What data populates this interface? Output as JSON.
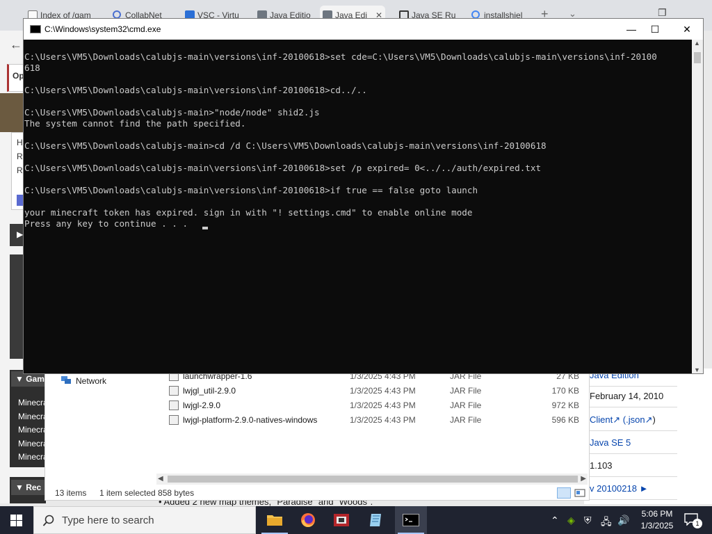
{
  "browser": {
    "tabs": [
      {
        "label": "Index of /gam",
        "icon": "file-page-icon",
        "color": "#6b6b6b"
      },
      {
        "label": "CollabNet",
        "icon": "magnifier-icon",
        "color": "#4a6fd0"
      },
      {
        "label": "VSC - Virtu",
        "icon": "vsc-icon",
        "color": "#2b6fd6"
      },
      {
        "label": "Java Editio",
        "icon": "minecraft-block-icon",
        "color": "#6e7680"
      },
      {
        "label": "Java Edi",
        "icon": "minecraft-block-icon",
        "color": "#6e7680"
      },
      {
        "label": "Java SE Ru",
        "icon": "pillars-icon",
        "color": "#333333"
      },
      {
        "label": "installshiel",
        "icon": "google-icon",
        "color": "#4285f4"
      }
    ],
    "left_fragments": {
      "op": "Op",
      "h": "H",
      "r1": "R",
      "r2": "R",
      "games_heading": "Gam",
      "minecraft_links": [
        "Minecra",
        "Minecra",
        "Minecra",
        "Minecra",
        "Minecra"
      ],
      "recent_heading": "Rec"
    },
    "wiki_infobox": {
      "row1": "Java Edition",
      "row2": "February 14, 2010",
      "row3_client": "Client",
      "row3_json": "(.json",
      "row3_end": ")",
      "row4": "Java SE 5",
      "row5": "1.103",
      "row6": "v 20100218 ►"
    },
    "page_bottom_text": "• Added 2 new map themes, \"Paradise\" and \"Woods\"."
  },
  "explorer": {
    "nav_item": "Network",
    "files": [
      {
        "name": "launchwrapper-1.6",
        "date": "1/3/2025 4:43 PM",
        "type": "JAR File",
        "size": "27 KB"
      },
      {
        "name": "lwjgl_util-2.9.0",
        "date": "1/3/2025 4:43 PM",
        "type": "JAR File",
        "size": "170 KB"
      },
      {
        "name": "lwjgl-2.9.0",
        "date": "1/3/2025 4:43 PM",
        "type": "JAR File",
        "size": "972 KB"
      },
      {
        "name": "lwjgl-platform-2.9.0-natives-windows",
        "date": "1/3/2025 4:43 PM",
        "type": "JAR File",
        "size": "596 KB"
      }
    ],
    "status": {
      "items": "13 items",
      "selected": "1 item selected  858 bytes"
    }
  },
  "cmd": {
    "title": "C:\\Windows\\system32\\cmd.exe",
    "lines": [
      "C:\\Users\\VM5\\Downloads\\calubjs-main\\versions\\inf-20100618>set cde=C:\\Users\\VM5\\Downloads\\calubjs-main\\versions\\inf-20100",
      "618",
      "",
      "C:\\Users\\VM5\\Downloads\\calubjs-main\\versions\\inf-20100618>cd../..",
      "",
      "C:\\Users\\VM5\\Downloads\\calubjs-main>\"node/node\" shid2.js",
      "The system cannot find the path specified.",
      "",
      "C:\\Users\\VM5\\Downloads\\calubjs-main>cd /d C:\\Users\\VM5\\Downloads\\calubjs-main\\versions\\inf-20100618",
      "",
      "C:\\Users\\VM5\\Downloads\\calubjs-main\\versions\\inf-20100618>set /p expired= 0<../../auth/expired.txt",
      "",
      "C:\\Users\\VM5\\Downloads\\calubjs-main\\versions\\inf-20100618>if true == false goto launch",
      "",
      "your minecraft token has expired. sign in with \"! settings.cmd\" to enable online mode",
      "Press any key to continue . . . "
    ]
  },
  "taskbar": {
    "search_placeholder": "Type here to search",
    "time": "5:06 PM",
    "date": "1/3/2025",
    "notification_count": "1",
    "accent": "#a8c7ff"
  }
}
